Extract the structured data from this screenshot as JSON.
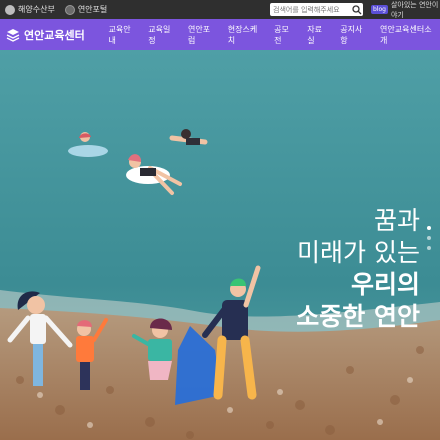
{
  "topbar": {
    "ministry_label": "해양수산부",
    "portal_label": "연안포털",
    "search_placeholder": "검색어를 입력해주세요",
    "story_badge": "blog",
    "story_label": "살아있는 연안이야기"
  },
  "nav": {
    "brand": "연안교육센터",
    "menu": [
      "교육안내",
      "교육일정",
      "연안포럼",
      "현장스케치",
      "공모전",
      "자료실",
      "공지사항",
      "연안교육센터소개"
    ]
  },
  "hero": {
    "line1": "꿈과",
    "line2": "미래가 있는",
    "line3": "우리의",
    "line4": "소중한 연안"
  },
  "colors": {
    "nav_purple": "#7c55de",
    "topbar_dark": "#2f2f2f",
    "sea": "#3f8f9a",
    "sand": "#b98f68"
  }
}
